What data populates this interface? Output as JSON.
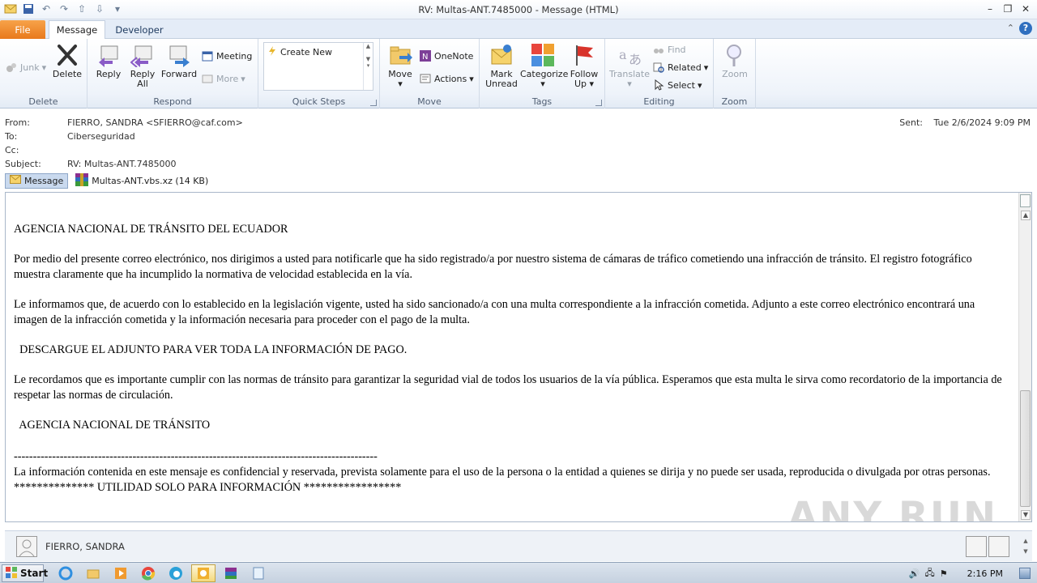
{
  "window": {
    "title": "RV: Multas-ANT.7485000  -  Message (HTML)"
  },
  "tabs": {
    "file": "File",
    "message": "Message",
    "developer": "Developer"
  },
  "ribbon": {
    "delete_group": {
      "label": "Delete",
      "junk": "Junk",
      "delete": "Delete"
    },
    "respond_group": {
      "label": "Respond",
      "reply": "Reply",
      "reply_all_1": "Reply",
      "reply_all_2": "All",
      "forward": "Forward",
      "meeting": "Meeting",
      "more": "More"
    },
    "quicksteps_group": {
      "label": "Quick Steps",
      "create_new": "Create New"
    },
    "move_group": {
      "label": "Move",
      "move": "Move",
      "onenote": "OneNote",
      "actions": "Actions"
    },
    "tags_group": {
      "label": "Tags",
      "mark_unread_1": "Mark",
      "mark_unread_2": "Unread",
      "categorize": "Categorize",
      "follow_up_1": "Follow",
      "follow_up_2": "Up"
    },
    "editing_group": {
      "label": "Editing",
      "translate": "Translate",
      "find": "Find",
      "related": "Related",
      "select": "Select"
    },
    "zoom_group": {
      "label": "Zoom",
      "zoom": "Zoom"
    }
  },
  "header": {
    "from_label": "From:",
    "from_value": "FIERRO, SANDRA <SFIERRO@caf.com>",
    "to_label": "To:",
    "to_value": "Ciberseguridad",
    "cc_label": "Cc:",
    "cc_value": "",
    "subject_label": "Subject:",
    "subject_value": "RV: Multas-ANT.7485000",
    "sent_label": "Sent:",
    "sent_value": "Tue 2/6/2024 9:09 PM"
  },
  "attachments": {
    "message_tab": "Message",
    "file": "Multas-ANT.vbs.xz (14 KB)"
  },
  "body": {
    "heading": "AGENCIA NACIONAL DE TRÁNSITO DEL ECUADOR",
    "p1": "Por medio del presente correo electrónico, nos dirigimos a usted para notificarle que ha sido registrado/a por nuestro sistema de cámaras de tráfico   cometiendo una infracción de tránsito. El registro fotográfico muestra claramente que ha incumplido la normativa de velocidad establecida en la vía.",
    "p2": "Le informamos que, de acuerdo con lo establecido en la legislación vigente, usted ha sido sancionado/a con una multa correspondiente a la infracción   cometida. Adjunto a este correo electrónico encontrará una imagen de la infracción cometida y la información necesaria para proceder con el pago de   la multa.",
    "p3": "  DESCARGUE EL ADJUNTO PARA VER TODA LA INFORMACIÓN DE PAGO.",
    "p4": "Le recordamos que es importante cumplir con las normas de tránsito para garantizar la seguridad vial de todos los usuarios de la vía pública.   Esperamos que esta multa le sirva como recordatorio de la importancia de respetar las normas de circulación.",
    "p5": "  AGENCIA NACIONAL DE TRÁNSITO",
    "divider": "-----------------------------------------------------------------------------------------------",
    "p6": "La información contenida en este mensaje es confidencial y reservada, prevista solamente para el uso de la persona o la entidad a quienes se dirija y no puede ser usada, reproducida o divulgada por otras personas.",
    "p7": "************** UTILIDAD SOLO PARA INFORMACIÓN *****************"
  },
  "watermark": "ANY RUN",
  "people_pane": {
    "name": "FIERRO, SANDRA"
  },
  "taskbar": {
    "start": "Start",
    "clock": "2:16 PM"
  }
}
